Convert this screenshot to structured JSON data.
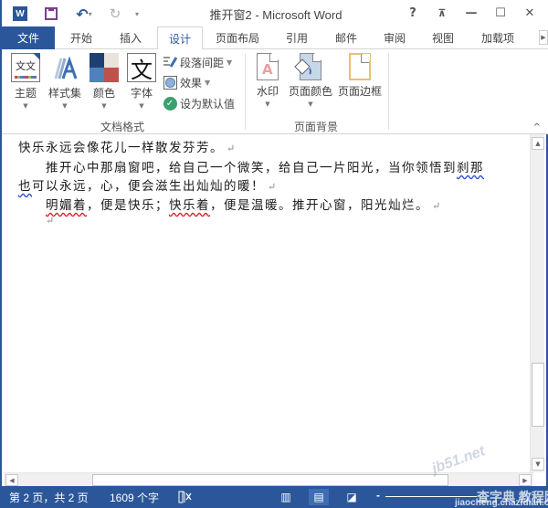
{
  "window": {
    "title": "推开窗2 - Microsoft Word",
    "controls": {
      "help": "?",
      "ribbon_display": "⊼",
      "minimize": "—",
      "maximize": "☐",
      "close": "✕"
    }
  },
  "quick_access": {
    "app_icon": "word-logo-icon",
    "app_letter": "W",
    "save": "save-icon",
    "undo": "undo-icon",
    "undo_glyph": "↶",
    "redo": "redo-icon",
    "redo_glyph": "↻",
    "customize": "customize-qat-icon",
    "dropdown_glyph": "▾"
  },
  "tabs": [
    {
      "label": "文件",
      "kind": "file"
    },
    {
      "label": "开始"
    },
    {
      "label": "插入"
    },
    {
      "label": "设计",
      "active": true
    },
    {
      "label": "页面布局"
    },
    {
      "label": "引用"
    },
    {
      "label": "邮件"
    },
    {
      "label": "审阅"
    },
    {
      "label": "视图"
    },
    {
      "label": "加载项"
    }
  ],
  "ribbon": {
    "groups": [
      {
        "label": "文档格式",
        "buttons": [
          {
            "label": "主题",
            "icon": "theme-icon",
            "dropdown": true
          },
          {
            "label": "样式集",
            "icon": "style-set-icon",
            "dropdown": true
          },
          {
            "label": "颜色",
            "icon": "colors-icon",
            "dropdown": true
          },
          {
            "label": "字体",
            "icon": "fonts-icon",
            "dropdown": true,
            "glyph": "文"
          }
        ],
        "small_buttons": [
          {
            "label": "段落间距",
            "icon": "paragraph-spacing-icon",
            "dropdown": true
          },
          {
            "label": "效果",
            "icon": "effects-icon",
            "dropdown": true
          },
          {
            "label": "设为默认值",
            "icon": "set-default-icon"
          }
        ]
      },
      {
        "label": "页面背景",
        "buttons": [
          {
            "label": "水印",
            "icon": "watermark-icon",
            "dropdown": true
          },
          {
            "label": "页面颜色",
            "icon": "page-color-icon",
            "dropdown": true
          },
          {
            "label": "页面边框",
            "icon": "page-borders-icon"
          }
        ]
      }
    ],
    "theme_glyph": "文文",
    "colors": [
      "#1f3f73",
      "#e8e4dc",
      "#4f81bd",
      "#c0504d"
    ],
    "collapse_glyph": "^"
  },
  "document": {
    "lines": [
      {
        "text": "快乐永远会像花儿一样散发芬芳。",
        "mark": "↵"
      },
      {
        "text": "推开心中那扇窗吧，给自己一个微笑，给自己一片阳光，当你领悟到",
        "tail": "刹那",
        "indent": true
      },
      {
        "head": "也",
        "text": "可以永远，心，便会滋生出灿灿的暖！",
        "mark": "↵"
      },
      {
        "seg1": "明媚着",
        "seg2": "，便是快乐；",
        "seg3": "快乐着",
        "seg4": "，便是温暖。推开心窗，阳光灿烂。",
        "mark": "↵",
        "indent": true
      },
      {
        "text": "",
        "mark": "↵",
        "indent": true
      }
    ]
  },
  "scrollbars": {
    "up": "▲",
    "down": "▼",
    "left": "◀",
    "right": "▶"
  },
  "status_bar": {
    "page": "第 2 页，共 2 页",
    "word_count": "1609 个字",
    "proofing_icon": "proofing-icon",
    "views": [
      {
        "name": "read-mode-icon",
        "glyph": "▥"
      },
      {
        "name": "print-layout-icon",
        "glyph": "▤",
        "active": true
      },
      {
        "name": "web-layout-icon",
        "glyph": "◪"
      }
    ],
    "zoom_minus": "-"
  },
  "watermarks": {
    "a": "jb51.net",
    "b": "查字典 教程网",
    "c": "jiaocheng.chazidian.com"
  },
  "colors": {
    "accent": "#2b579a",
    "status_bg": "#2b579a"
  }
}
